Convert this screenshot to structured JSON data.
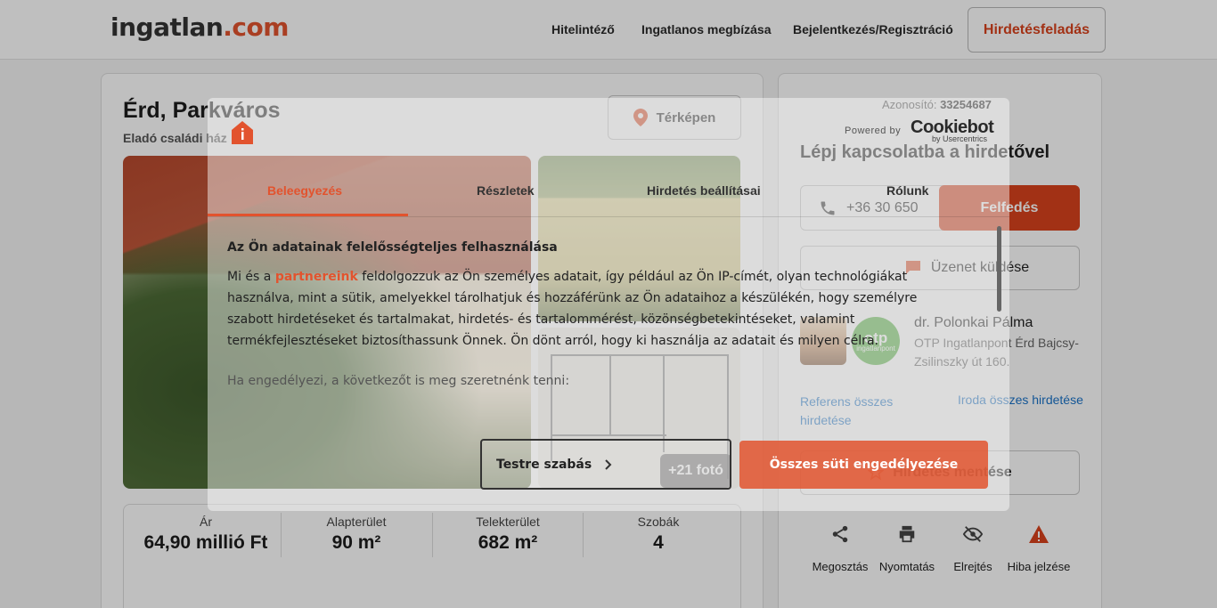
{
  "header": {
    "logo_main": "ingatlan",
    "logo_tld": ".com",
    "nav": [
      "Hitelintéző",
      "Ingatlanos megbízása",
      "Bejelentkezés/Regisztráció"
    ],
    "post_button": "Hirdetésfeladás"
  },
  "listing": {
    "title": "Érd, Parkváros",
    "subtitle": "Eladó családi ház",
    "map_button": "Térképen",
    "more_photos": "+21 fotó",
    "stats": [
      {
        "label": "Ár",
        "value": "64,90 millió Ft"
      },
      {
        "label": "Alapterület",
        "value": "90 m²"
      },
      {
        "label": "Telekterület",
        "value": "682 m²"
      },
      {
        "label": "Szobák",
        "value": "4"
      }
    ]
  },
  "sidebar": {
    "id_label": "Azonosító:",
    "id_value": "33254687",
    "contact_title": "Lépj kapcsolatba a hirdetővel",
    "phone": "+36 30 650",
    "reveal_button": "Felfedés",
    "message_button": "Üzenet küldése",
    "agent_name": "dr. Polonkai Pálma",
    "agent_office": "OTP Ingatlanpont Érd Bajcsy-Zsilinszky út 160.",
    "otp_logo": "otp",
    "otp_logo_sub": "ingatlanpont",
    "ref_link": "Referens összes hirdetése",
    "office_link": "Iroda összes hirdetése",
    "save_button": "Hirdetés mentése",
    "actions": [
      "Megosztás",
      "Nyomtatás",
      "Elrejtés",
      "Hiba jelzése"
    ]
  },
  "cookie_modal": {
    "powered_by": "Powered by",
    "brand": "Cookiebot",
    "brand_sub": "by Usercentrics",
    "tabs": [
      "Beleegyezés",
      "Részletek",
      "Hirdetés beállításai",
      "Rólunk"
    ],
    "heading": "Az Ön adatainak felelősségteljes felhasználása",
    "body_prefix": "Mi és a ",
    "body_link": "partnereink",
    "body_rest": " feldolgozzuk az Ön személyes adatait, így például az Ön IP-címét, olyan technológiákat használva, mint a sütik, amelyekkel tárolhatjuk és hozzáférünk az Ön adataihoz a készülékén, hogy személyre szabott hirdetéseket és tartalmakat, hirdetés- és tartalommérést, közönségbetekintéseket, valamint termékfejlesztéseket biztosíthassunk Önnek. Ön dönt arról, hogy ki használja az adatait és milyen célra.",
    "extra": "Ha engedélyezi, a következőt is meg szeretnénk tenni:",
    "customize_button": "Testre szabás",
    "accept_button": "Összes süti engedélyezése"
  },
  "colors": {
    "accent": "#e2532e",
    "link": "#1a73c8",
    "otp_green": "#5ab646"
  }
}
